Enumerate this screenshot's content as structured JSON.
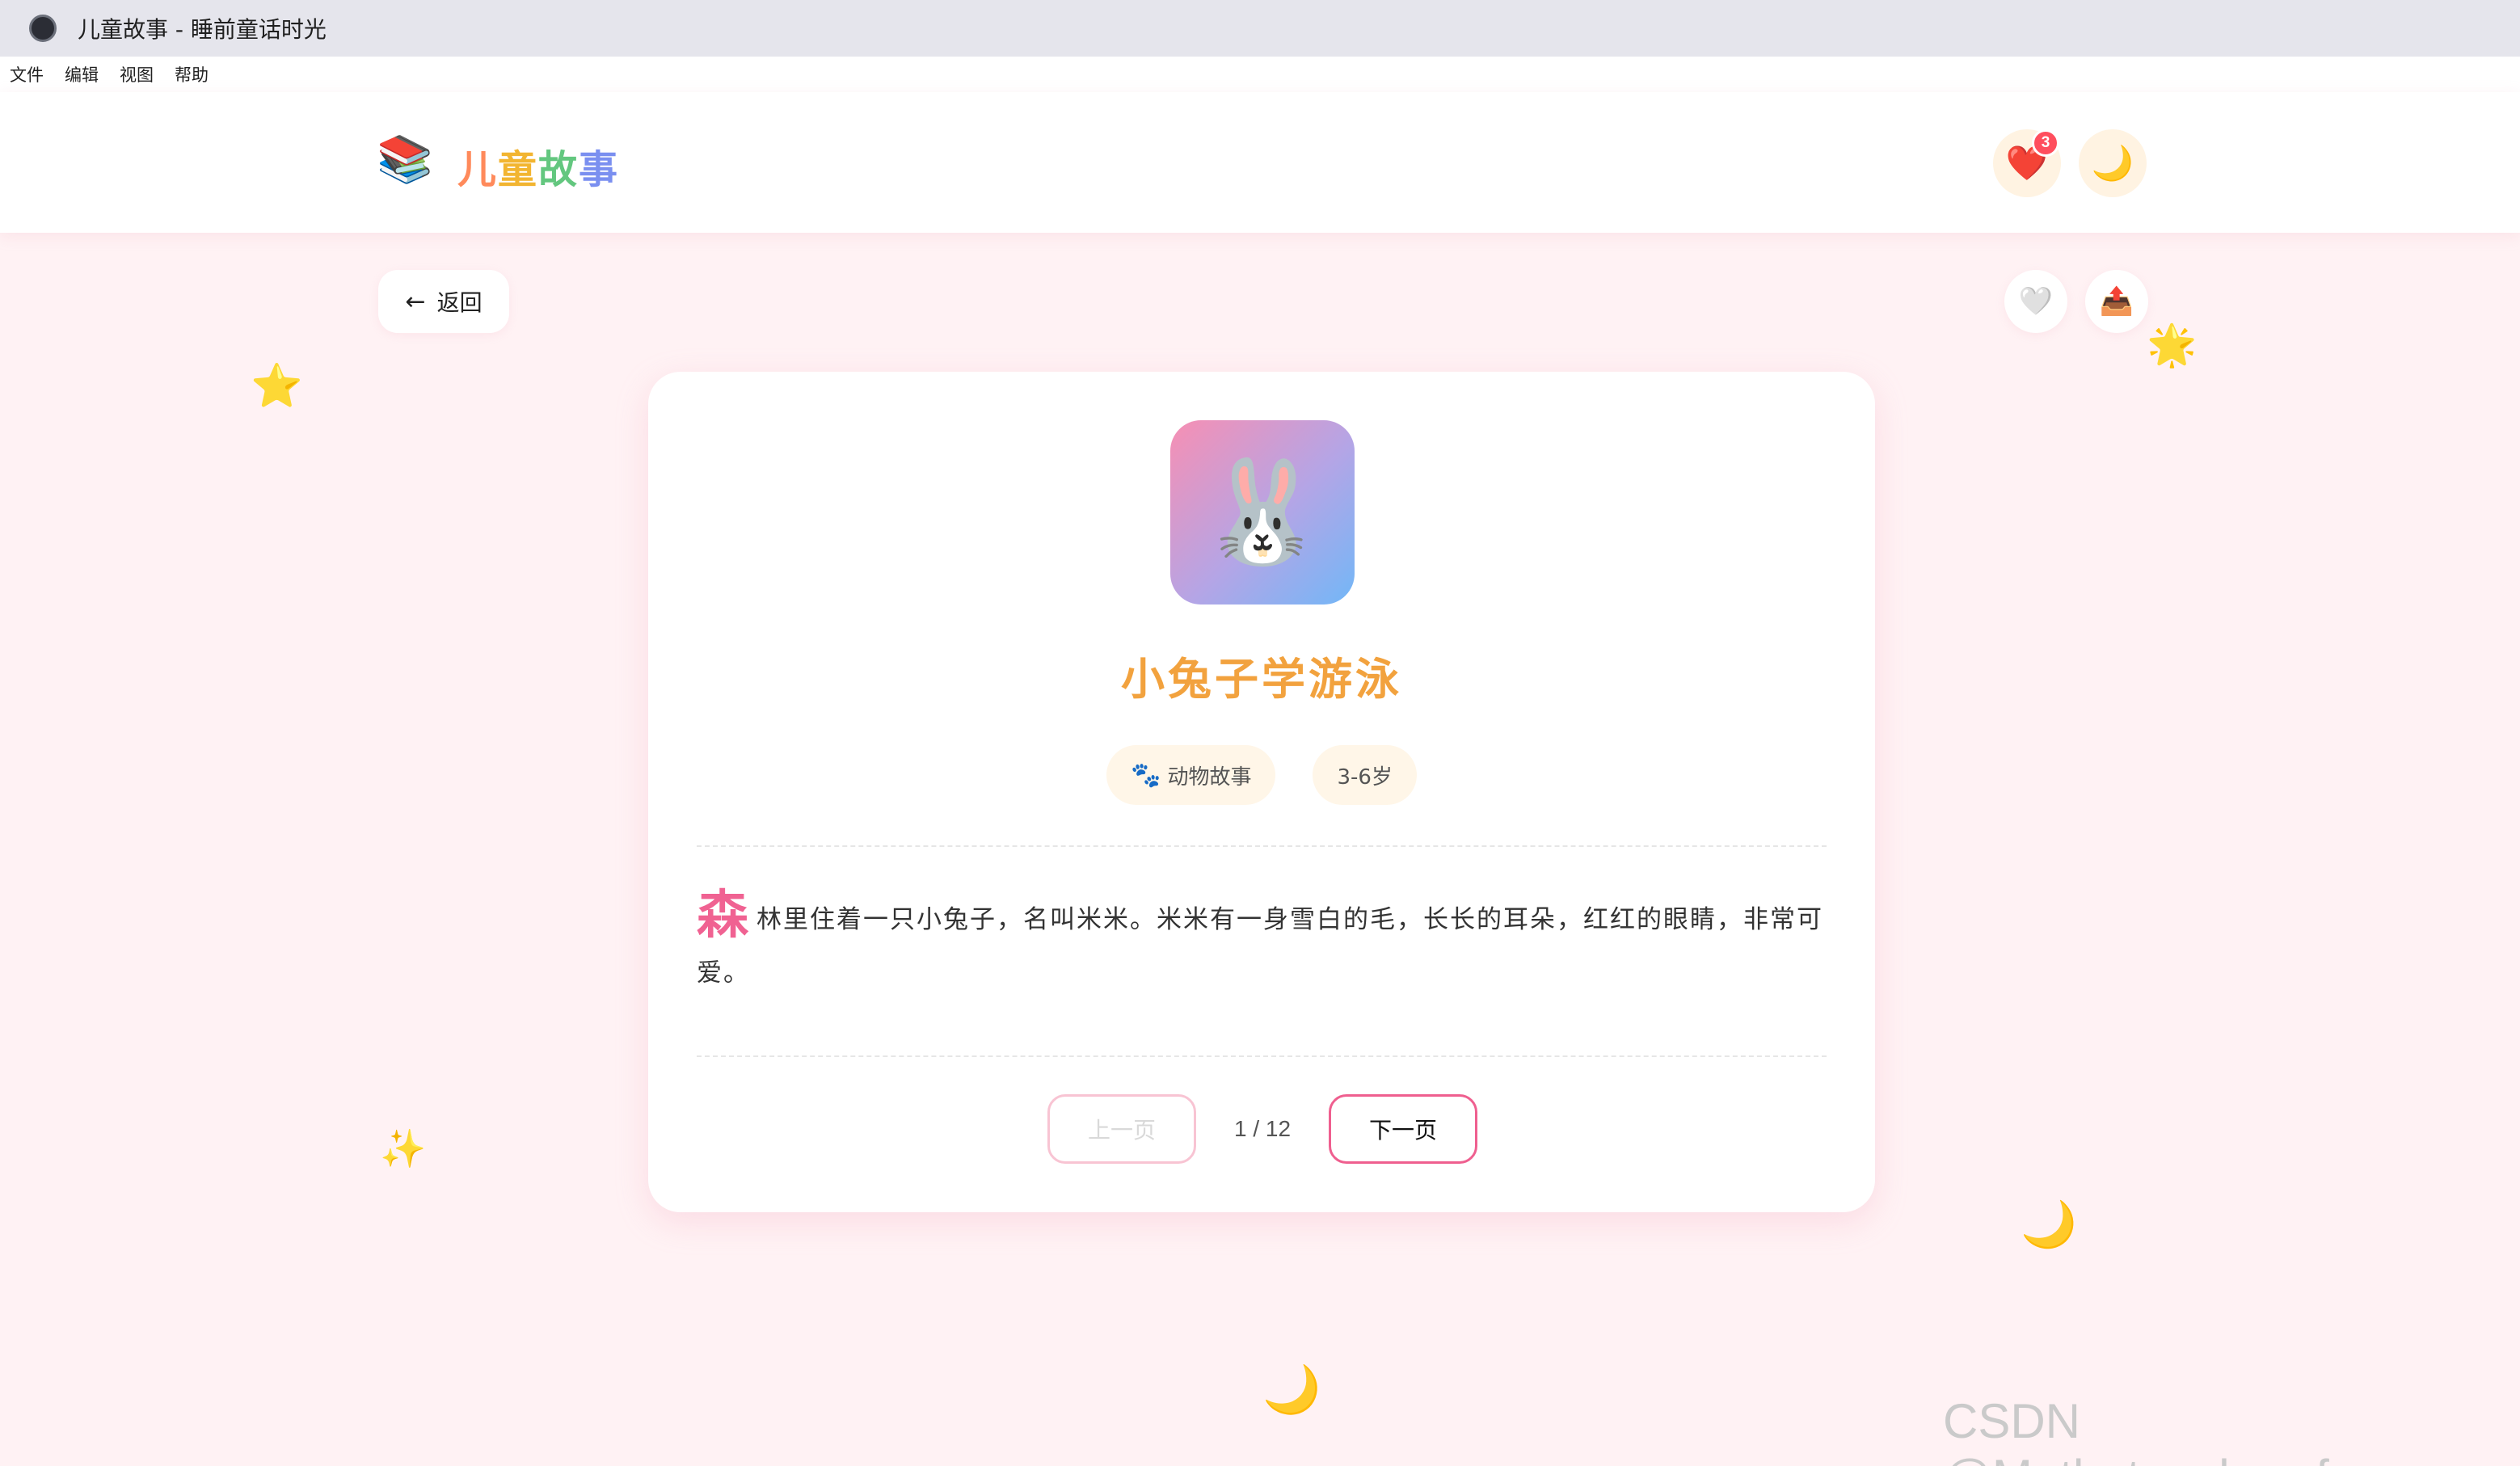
{
  "window": {
    "title": "儿童故事 - 睡前童话时光",
    "icon": "app-icon"
  },
  "menu": [
    "文件",
    "编辑",
    "视图",
    "帮助"
  ],
  "header": {
    "logo_icon": "📚",
    "logo_chars": [
      "儿",
      "童",
      "故",
      "事"
    ],
    "favorites_icon": "❤️",
    "favorites_count": "3",
    "night_mode_icon": "🌙"
  },
  "actions": {
    "back_label": "返回",
    "back_arrow": "←",
    "like_icon": "🤍",
    "share_icon": "📤"
  },
  "decorations": [
    "⭐",
    "🌟",
    "✨",
    "🌙",
    "🌙"
  ],
  "story": {
    "cover_emoji": "🐰",
    "title": "小兔子学游泳",
    "tags": [
      {
        "icon": "🐾",
        "label": "动物故事"
      },
      {
        "label": "3-6岁"
      }
    ],
    "drop_cap": "森",
    "text": "林里住着一只小兔子，名叫米米。米米有一身雪白的毛，长长的耳朵，红红的眼睛，非常可爱。"
  },
  "pager": {
    "prev_label": "上一页",
    "next_label": "下一页",
    "indicator": "1 / 12"
  },
  "watermark": "CSDN @Math_teacher_fan",
  "colors": {
    "background": "#fff2f4",
    "title": "#f2a23e",
    "accent_pink": "#f06292",
    "tag_bg": "#fff6e8"
  }
}
